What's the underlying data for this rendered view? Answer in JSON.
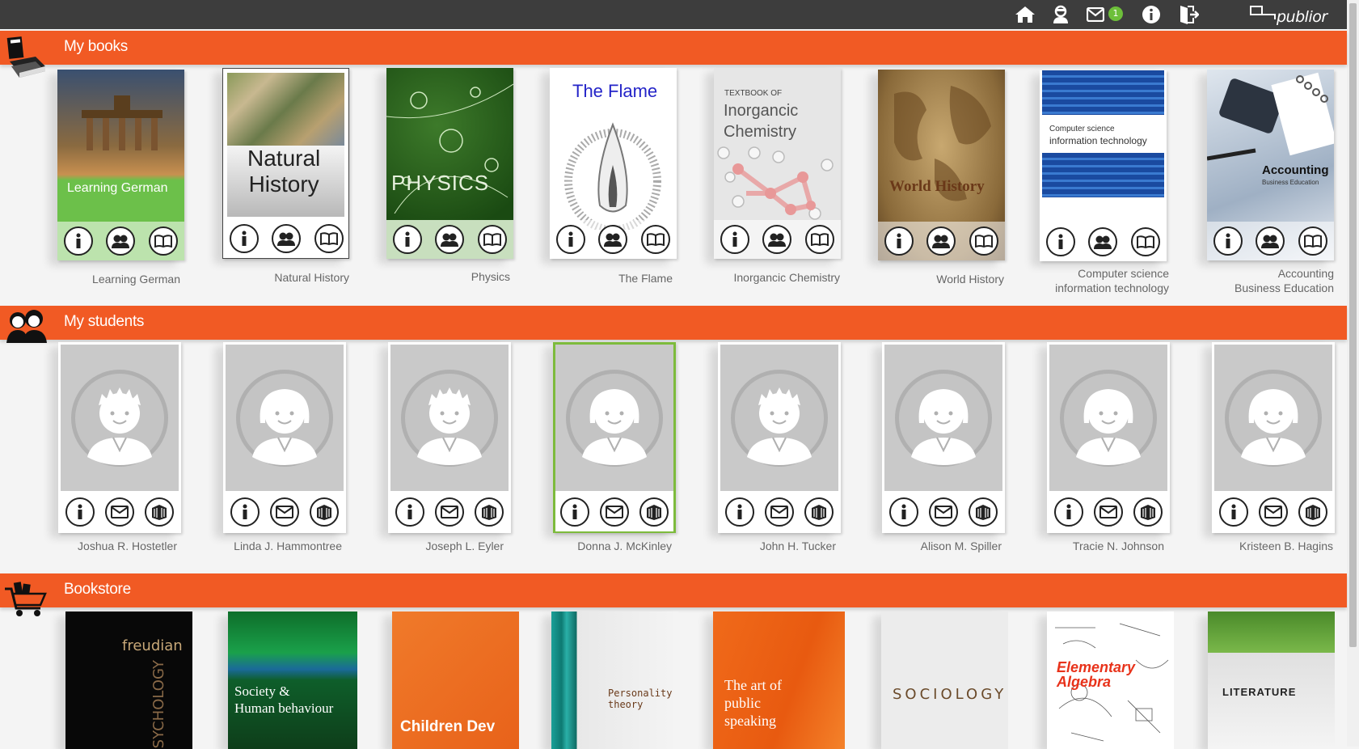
{
  "topbar": {
    "icons": [
      "home-icon",
      "teacher-icon",
      "mail-icon",
      "info-icon",
      "logout-icon"
    ],
    "mail_count": "1",
    "logo_text": "publior"
  },
  "sections": {
    "books": "My books",
    "students": "My students",
    "store": "Bookstore"
  },
  "books": [
    {
      "cover_title": "Learning German",
      "label": "Learning German"
    },
    {
      "cover_title": "Natural\nHistory",
      "label": "Natural History"
    },
    {
      "cover_title": "PHYSICS",
      "label": "Physics"
    },
    {
      "cover_title": "The Flame",
      "label": "The Flame"
    },
    {
      "cover_kicker": "TEXTBOOK OF",
      "cover_title": "Inorgancic\nChemistry",
      "label": "Inorgancic Chemistry"
    },
    {
      "cover_title": "World History",
      "label": "World History"
    },
    {
      "cover_kicker": "Computer science",
      "cover_title": "information technology",
      "label": "Computer science\ninformation technology"
    },
    {
      "cover_title": "Accounting",
      "cover_sub": "Business Education",
      "label": "Accounting\nBusiness Education"
    }
  ],
  "book_actions": [
    "info-icon",
    "students-icon",
    "read-book-icon"
  ],
  "students": [
    {
      "name": "Joshua R. Hostetler",
      "avatar": "boy"
    },
    {
      "name": "Linda J. Hammontree",
      "avatar": "girl"
    },
    {
      "name": "Joseph L. Eyler",
      "avatar": "boy"
    },
    {
      "name": "Donna J. McKinley",
      "avatar": "girl",
      "selected": true
    },
    {
      "name": "John H. Tucker",
      "avatar": "boy"
    },
    {
      "name": "Alison M. Spiller",
      "avatar": "girl"
    },
    {
      "name": "Tracie N. Johnson",
      "avatar": "girl"
    },
    {
      "name": "Kristeen B. Hagins",
      "avatar": "girl"
    }
  ],
  "student_actions": [
    "info-icon",
    "message-icon",
    "books-icon"
  ],
  "store": [
    {
      "title": "freudian",
      "sub": "PSYCHOLOGY"
    },
    {
      "title": "Society &\nHuman behaviour"
    },
    {
      "title": "Children Dev"
    },
    {
      "title": "Personality\ntheory"
    },
    {
      "title": "The art of\npublic\nspeaking"
    },
    {
      "title": "SOCIOLOGY"
    },
    {
      "title": "Elementary\nAlgebra"
    },
    {
      "title": "LITERATURE"
    }
  ],
  "colors": {
    "accent": "#f15a24",
    "topbar": "#3d3d3d",
    "selected": "#7dbb3c",
    "badge": "#6dbf3a"
  }
}
